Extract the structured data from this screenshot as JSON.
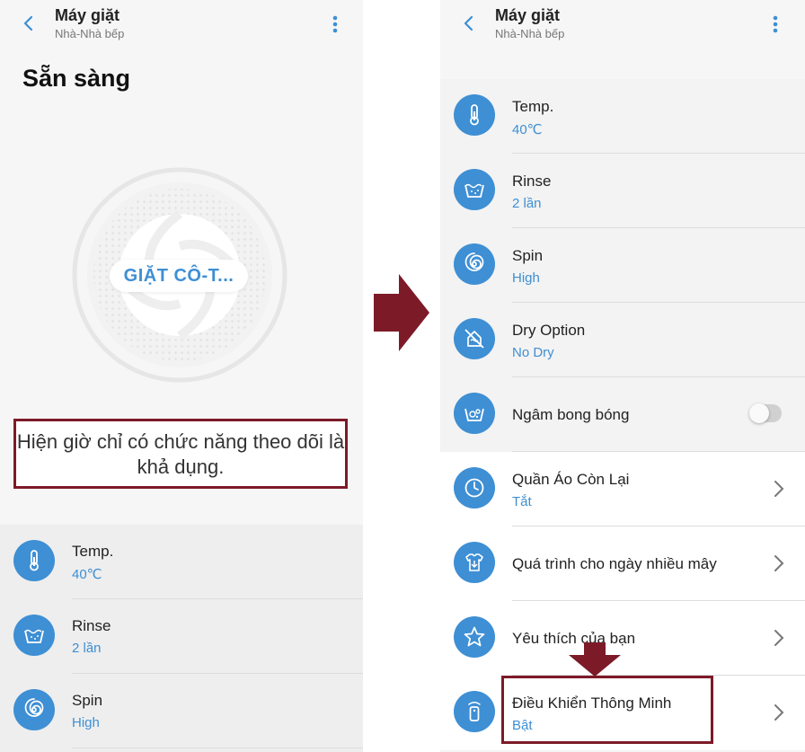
{
  "colors": {
    "accent": "#3e8fd4",
    "annotation": "#7d1a28"
  },
  "left": {
    "app_title": "Máy giặt",
    "app_subtitle": "Nhà-Nhà bếp",
    "status": "Sẵn sàng",
    "dial_label": "GIẶT CÔ-T...",
    "notice": "Hiện giờ chỉ có chức năng theo dõi là khả dụng.",
    "items": [
      {
        "label": "Temp.",
        "value": "40℃",
        "icon": "thermometer-icon"
      },
      {
        "label": "Rinse",
        "value": "2 lần",
        "icon": "rinse-tub-icon"
      },
      {
        "label": "Spin",
        "value": "High",
        "icon": "spin-spiral-icon"
      }
    ]
  },
  "right": {
    "app_title": "Máy giặt",
    "app_subtitle": "Nhà-Nhà bếp",
    "items": [
      {
        "label": "Temp.",
        "value": "40℃",
        "icon": "thermometer-icon"
      },
      {
        "label": "Rinse",
        "value": "2 lần",
        "icon": "rinse-tub-icon"
      },
      {
        "label": "Spin",
        "value": "High",
        "icon": "spin-spiral-icon"
      },
      {
        "label": "Dry Option",
        "value": "No Dry",
        "icon": "no-dry-icon"
      },
      {
        "label": "Ngâm bong bóng",
        "value": "",
        "icon": "bubble-soak-icon",
        "toggle_on": false
      },
      {
        "label": "Quần Áo Còn Lại",
        "value": "Tắt",
        "icon": "timer-icon"
      },
      {
        "label": "Quá trình cho ngày nhiều mây",
        "value": "",
        "icon": "cloudy-day-shirt-icon"
      },
      {
        "label": "Yêu thích của bạn",
        "value": "",
        "icon": "star-icon"
      },
      {
        "label": "Điều Khiển Thông Minh",
        "value": "Bật",
        "icon": "smart-control-icon"
      }
    ]
  }
}
